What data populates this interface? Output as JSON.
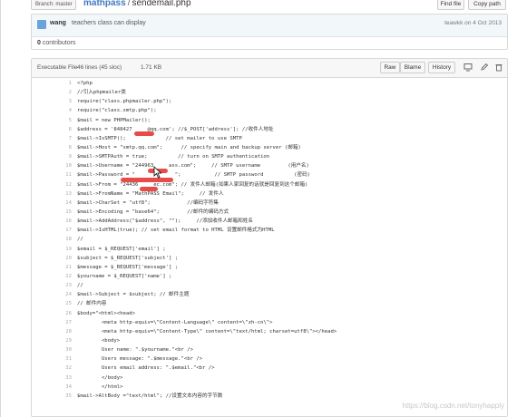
{
  "topbar": {
    "branch_label": "Branch: master ▾",
    "repo": "mathpass",
    "separator": "/",
    "filename": "sendemail.php",
    "find_file": "Find file",
    "copy_path": "Copy path"
  },
  "commit": {
    "author": "wang",
    "message": "teachers class can display",
    "sha_date": "teawkk on 4 Oct 2013",
    "contributors_count": "0",
    "contributors_label": "contributors"
  },
  "file": {
    "mode": "Executable File",
    "lines": "46 lines (45 sloc)",
    "size": "1.71 KB",
    "raw": "Raw",
    "blame": "Blame",
    "history": "History"
  },
  "code_lines": [
    {
      "n": "1",
      "t": "<?php"
    },
    {
      "n": "2",
      "t": "//引入phpmailer类"
    },
    {
      "n": "3",
      "t": "require(\"class.phpmailer.php\");"
    },
    {
      "n": "4",
      "t": "require(\"class.smtp.php\");"
    },
    {
      "n": "5",
      "t": "$mail = new PHPMailer();"
    },
    {
      "n": "6",
      "t": "$address = '848427     @qq.com'; //$_POST['address']; //收件人地址"
    },
    {
      "n": "7",
      "t": "$mail->IsSMTP();             // set mailer to use SMTP"
    },
    {
      "n": "8",
      "t": "$mail->Host = \"smtp.qq.com\";      // specify main and backup server (邮箱)"
    },
    {
      "n": "9",
      "t": "$mail->SMTPAuth = true;          // turn on SMTP authentication"
    },
    {
      "n": "10",
      "t": "$mail->Username = \"244963     ass.com\";     // SMTP username         (用户名)"
    },
    {
      "n": "11",
      "t": "$mail->Password = \"             \";           // SMTP password          (密码)"
    },
    {
      "n": "12",
      "t": "$mail->From = \"24436     ec.com\"; // 发件人邮箱(如果人家回复的话就是回复到这个邮箱)"
    },
    {
      "n": "13",
      "t": "$mail->FromName = \"MathPASS Email\";     // 发件人"
    },
    {
      "n": "14",
      "t": "$mail->CharSet = \"utf8\";            //编码字符集"
    },
    {
      "n": "15",
      "t": "$mail->Encoding = \"base64\";         //邮件的编码方式"
    },
    {
      "n": "16",
      "t": "$mail->AddAddress(\"$address\", \"\");     //添加收件人邮箱和姓名"
    },
    {
      "n": "17",
      "t": "$mail->IsHTML(true); // set email format to HTML 设置邮件格式为HTML"
    },
    {
      "n": "18",
      "t": "//"
    },
    {
      "n": "19",
      "t": "$email = $_REQUEST['email'] ;"
    },
    {
      "n": "20",
      "t": "$subject = $_REQUEST['subject'] ;"
    },
    {
      "n": "21",
      "t": "$message = $_REQUEST['message'] ;"
    },
    {
      "n": "22",
      "t": "$yourname = $_REQUEST['name'] ;"
    },
    {
      "n": "23",
      "t": "//"
    },
    {
      "n": "24",
      "t": "$mail->Subject = $subject; // 邮件主题"
    },
    {
      "n": "25",
      "t": "// 邮件内容"
    },
    {
      "n": "26",
      "t": "$body=\"<html><head>"
    },
    {
      "n": "27",
      "t": "        <meta http-equiv=\\\"Content-Language\\\" content=\\\"zh-cn\\\">"
    },
    {
      "n": "28",
      "t": "        <meta http-equiv=\\\"Content-Type\\\" content=\\\"text/html; charset=utf8\\\"></head>"
    },
    {
      "n": "29",
      "t": "        <body>"
    },
    {
      "n": "30",
      "t": "        User name: \".$yourname.\"<br />"
    },
    {
      "n": "31",
      "t": "        Users message: \".$message.\"<br />"
    },
    {
      "n": "32",
      "t": "        Users email address: \".$email.\"<br />"
    },
    {
      "n": "33",
      "t": "        </body>"
    },
    {
      "n": "34",
      "t": "        </html>"
    },
    {
      "n": "35",
      "t": "$mail->AltBody =\"text/html\"; //设置文本内容的字节数"
    }
  ],
  "watermark": "https://blog.csdn.net/tonyhapply"
}
